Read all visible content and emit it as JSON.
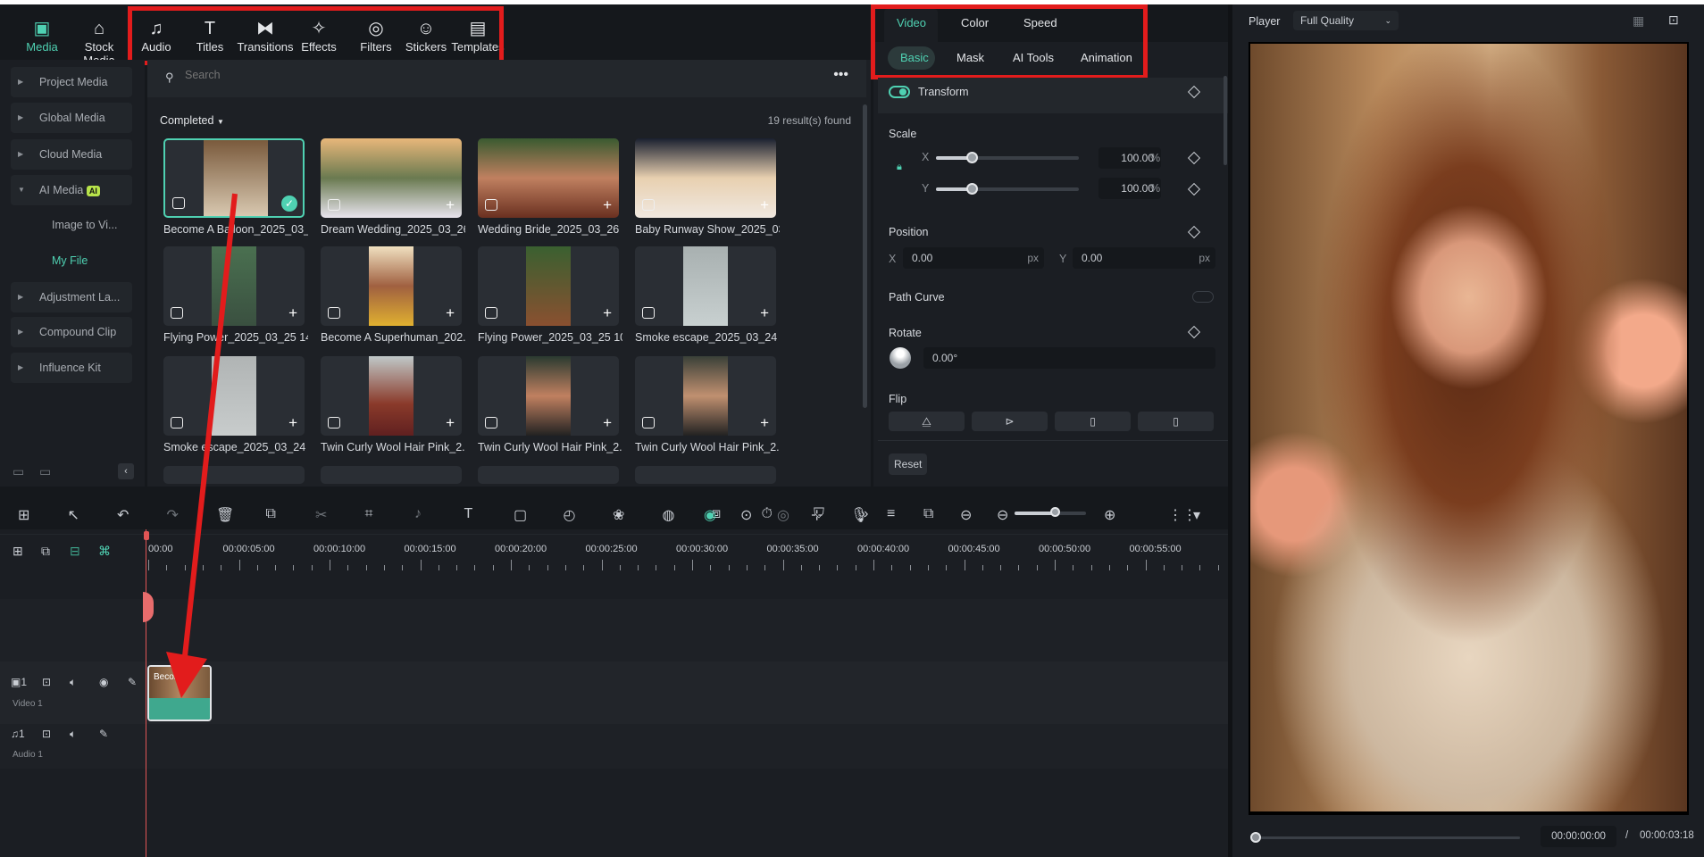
{
  "top_nav": [
    {
      "label": "Media",
      "icon": "media-icon",
      "glyph": "▣",
      "active": true
    },
    {
      "label": "Stock Media",
      "icon": "store-icon",
      "glyph": "⌂"
    },
    {
      "label": "Audio",
      "icon": "music-note-icon",
      "glyph": "♫"
    },
    {
      "label": "Titles",
      "icon": "text-icon",
      "glyph": "T"
    },
    {
      "label": "Transitions",
      "icon": "transition-icon",
      "glyph": "⧓"
    },
    {
      "label": "Effects",
      "icon": "effects-star-icon",
      "glyph": "✧"
    },
    {
      "label": "Filters",
      "icon": "filter-icon",
      "glyph": "◎"
    },
    {
      "label": "Stickers",
      "icon": "sticker-icon",
      "glyph": "☺"
    },
    {
      "label": "Templates",
      "icon": "template-icon",
      "glyph": "▤"
    }
  ],
  "sidebar": {
    "items": [
      {
        "label": "Project Media",
        "expanded": false
      },
      {
        "label": "Global Media",
        "expanded": false
      },
      {
        "label": "Cloud Media",
        "expanded": false
      },
      {
        "label": "AI Media",
        "expanded": true,
        "badge": "AI"
      },
      {
        "label": "Adjustment La...",
        "expanded": false
      },
      {
        "label": "Compound Clip",
        "expanded": false
      },
      {
        "label": "Influence Kit",
        "expanded": false
      }
    ],
    "subitems": [
      {
        "label": "Image to Vi..."
      },
      {
        "label": "My File",
        "active": true
      }
    ]
  },
  "browser": {
    "search_placeholder": "Search",
    "filter": "Completed",
    "results": "19 result(s) found",
    "items": [
      {
        "label": "Become A Balloon_2025_03_...",
        "selected": true
      },
      {
        "label": "Dream Wedding_2025_03_26..."
      },
      {
        "label": "Wedding Bride_2025_03_26 1..."
      },
      {
        "label": "Baby Runway Show_2025_03..."
      },
      {
        "label": "Flying Power_2025_03_25 14..."
      },
      {
        "label": "Become A Superhuman_202..."
      },
      {
        "label": "Flying Power_2025_03_25 10..."
      },
      {
        "label": "Smoke escape_2025_03_24 1..."
      },
      {
        "label": "Smoke escape_2025_03_24 1..."
      },
      {
        "label": "Twin Curly Wool Hair Pink_2..."
      },
      {
        "label": "Twin Curly Wool Hair Pink_2..."
      },
      {
        "label": "Twin Curly Wool Hair Pink_2..."
      }
    ]
  },
  "props": {
    "tabs": [
      "Video",
      "Color",
      "Speed"
    ],
    "subtabs": [
      "Basic",
      "Mask",
      "AI Tools",
      "Animation"
    ],
    "transform": "Transform",
    "scale": {
      "label": "Scale",
      "x": "100.00",
      "y": "100.00",
      "unit": "%",
      "x_label": "X",
      "y_label": "Y",
      "slider_percent": 25
    },
    "position": {
      "label": "Position",
      "x": "0.00",
      "y": "0.00",
      "unit": "px",
      "x_label": "X",
      "y_label": "Y"
    },
    "path_curve": "Path Curve",
    "rotate": {
      "label": "Rotate",
      "value": "0.00°"
    },
    "flip": "Flip",
    "reset": "Reset"
  },
  "player": {
    "label": "Player",
    "quality": "Full Quality",
    "current": "00:00:00:00",
    "separator": "/",
    "total": "00:00:03:18",
    "progress": 0
  },
  "timeline": {
    "ruler": [
      "00:00",
      "00:00:05:00",
      "00:00:10:00",
      "00:00:15:00",
      "00:00:20:00",
      "00:00:25:00",
      "00:00:30:00",
      "00:00:35:00",
      "00:00:40:00",
      "00:00:45:00",
      "00:00:50:00",
      "00:00:55:00"
    ],
    "video_track": "Video 1",
    "audio_track": "Audio 1",
    "track_num": "1",
    "clip_label": "Becom..."
  },
  "colors": {
    "accent": "#4fd1b2",
    "annotation": "#e21c1c",
    "clip": "#3fa88e"
  }
}
